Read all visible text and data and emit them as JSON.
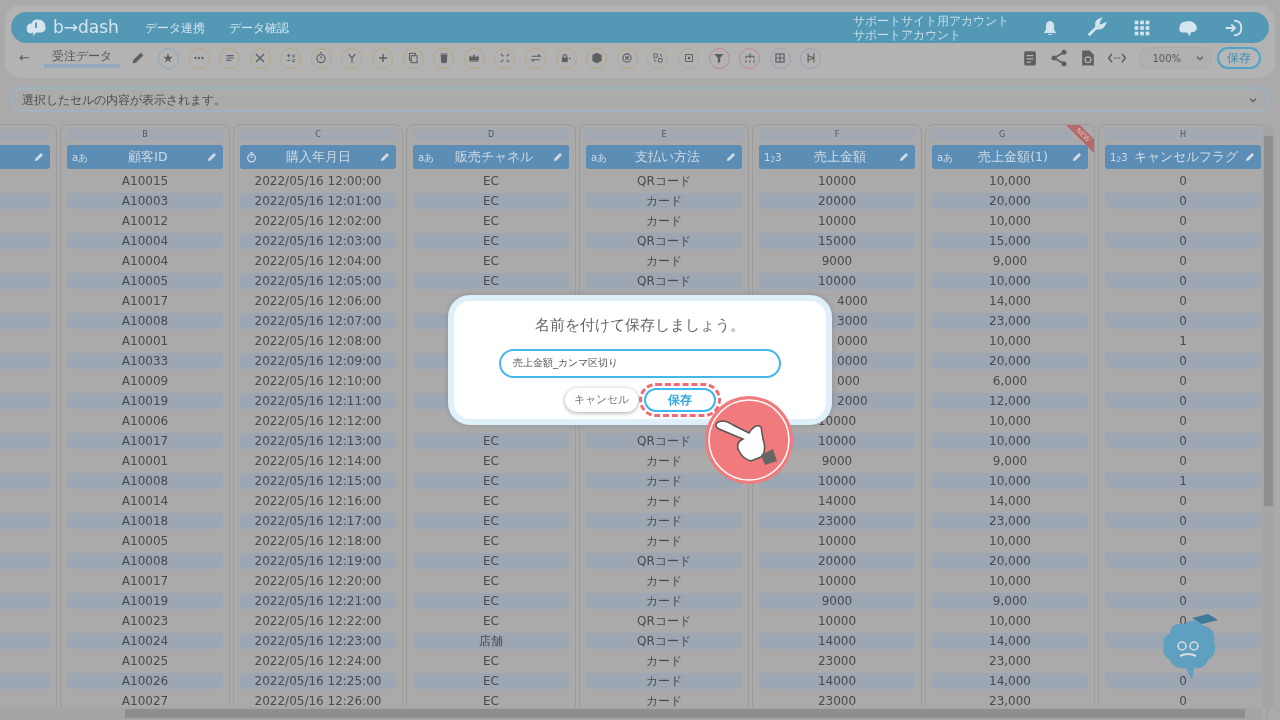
{
  "header": {
    "logo": "b→dash",
    "nav": [
      {
        "label": "データ連携"
      },
      {
        "label": "データ確認"
      }
    ],
    "account": [
      "サポートサイト用アカウント",
      "サポートアカウント"
    ]
  },
  "toolbar": {
    "back": "←",
    "sheet_name": "受注データ",
    "zoom": "100%",
    "save": "保存"
  },
  "formula_bar": {
    "placeholder": "選択したセルの内容が表示されます。"
  },
  "columns": [
    {
      "letter": "B",
      "kind": "text",
      "type_label": "aあ",
      "name": "顧客ID"
    },
    {
      "letter": "C",
      "kind": "datetime",
      "name": "購入年月日"
    },
    {
      "letter": "D",
      "kind": "text",
      "type_label": "aあ",
      "name": "販売チャネル"
    },
    {
      "letter": "E",
      "kind": "text",
      "type_label": "aあ",
      "name": "支払い方法"
    },
    {
      "letter": "F",
      "kind": "number",
      "type_label": "1$_{2}$3",
      "name": "売上金額"
    },
    {
      "letter": "G",
      "kind": "text",
      "type_label": "aあ",
      "name": "売上金額(1)",
      "badge": "NEW"
    },
    {
      "letter": "H",
      "kind": "number",
      "type_label": "1$_{2}$3",
      "name": "キャンセルフラグ"
    }
  ],
  "rows": [
    {
      "covered": false,
      "cells": [
        "A10015",
        "2022/05/16 12:00:00",
        "EC",
        "QRコード",
        "10000",
        "10,000",
        "0"
      ]
    },
    {
      "covered": false,
      "cells": [
        "A10003",
        "2022/05/16 12:01:00",
        "EC",
        "カード",
        "20000",
        "20,000",
        "0"
      ]
    },
    {
      "covered": false,
      "cells": [
        "A10012",
        "2022/05/16 12:02:00",
        "EC",
        "カード",
        "10000",
        "10,000",
        "0"
      ]
    },
    {
      "covered": false,
      "cells": [
        "A10004",
        "2022/05/16 12:03:00",
        "EC",
        "QRコード",
        "15000",
        "15,000",
        "0"
      ]
    },
    {
      "covered": false,
      "cells": [
        "A10004",
        "2022/05/16 12:04:00",
        "EC",
        "カード",
        "9000",
        "9,000",
        "0"
      ]
    },
    {
      "covered": false,
      "cells": [
        "A10005",
        "2022/05/16 12:05:00",
        "EC",
        "QRコード",
        "10000",
        "10,000",
        "0"
      ]
    },
    {
      "covered": true,
      "cells": [
        "A10017",
        "2022/05/16 12:06:00",
        null,
        null,
        "4000",
        "14,000",
        "0"
      ]
    },
    {
      "covered": true,
      "cells": [
        "A10008",
        "2022/05/16 12:07:00",
        null,
        null,
        "3000",
        "23,000",
        "0"
      ]
    },
    {
      "covered": true,
      "cells": [
        "A10001",
        "2022/05/16 12:08:00",
        null,
        null,
        "0000",
        "10,000",
        "1"
      ]
    },
    {
      "covered": true,
      "cells": [
        "A10033",
        "2022/05/16 12:09:00",
        null,
        null,
        "0000",
        "20,000",
        "0"
      ]
    },
    {
      "covered": true,
      "cells": [
        "A10009",
        "2022/05/16 12:10:00",
        null,
        null,
        "000",
        "6,000",
        "0"
      ]
    },
    {
      "covered": true,
      "cells": [
        "A10019",
        "2022/05/16 12:11:00",
        null,
        null,
        "2000",
        "12,000",
        "0"
      ]
    },
    {
      "covered": false,
      "cells": [
        "A10006",
        "2022/05/16 12:12:00",
        null,
        null,
        "10000",
        "10,000",
        "0"
      ]
    },
    {
      "covered": false,
      "cells": [
        "A10017",
        "2022/05/16 12:13:00",
        "EC",
        "QRコード",
        "10000",
        "10,000",
        "0"
      ]
    },
    {
      "covered": false,
      "cells": [
        "A10001",
        "2022/05/16 12:14:00",
        "EC",
        "カード",
        "9000",
        "9,000",
        "0"
      ]
    },
    {
      "covered": false,
      "cells": [
        "A10008",
        "2022/05/16 12:15:00",
        "EC",
        "カード",
        "10000",
        "10,000",
        "1"
      ]
    },
    {
      "covered": false,
      "cells": [
        "A10014",
        "2022/05/16 12:16:00",
        "EC",
        "カード",
        "14000",
        "14,000",
        "0"
      ]
    },
    {
      "covered": false,
      "cells": [
        "A10018",
        "2022/05/16 12:17:00",
        "EC",
        "カード",
        "23000",
        "23,000",
        "0"
      ]
    },
    {
      "covered": false,
      "cells": [
        "A10005",
        "2022/05/16 12:18:00",
        "EC",
        "カード",
        "10000",
        "10,000",
        "0"
      ]
    },
    {
      "covered": false,
      "cells": [
        "A10008",
        "2022/05/16 12:19:00",
        "EC",
        "QRコード",
        "20000",
        "20,000",
        "0"
      ]
    },
    {
      "covered": false,
      "cells": [
        "A10017",
        "2022/05/16 12:20:00",
        "EC",
        "カード",
        "10000",
        "10,000",
        "0"
      ]
    },
    {
      "covered": false,
      "cells": [
        "A10019",
        "2022/05/16 12:21:00",
        "EC",
        "カード",
        "9000",
        "9,000",
        "0"
      ]
    },
    {
      "covered": false,
      "cells": [
        "A10023",
        "2022/05/16 12:22:00",
        "EC",
        "QRコード",
        "10000",
        "10,000",
        "0"
      ]
    },
    {
      "covered": false,
      "cells": [
        "A10024",
        "2022/05/16 12:23:00",
        "店舗",
        "QRコード",
        "14000",
        "14,000",
        null
      ]
    },
    {
      "covered": false,
      "cells": [
        "A10025",
        "2022/05/16 12:24:00",
        "EC",
        "カード",
        "23000",
        "23,000",
        null
      ]
    },
    {
      "covered": false,
      "cells": [
        "A10026",
        "2022/05/16 12:25:00",
        "EC",
        "カード",
        "14000",
        "14,000",
        "0"
      ]
    },
    {
      "covered": false,
      "cells": [
        "A10027",
        "2022/05/16 12:26:00",
        "EC",
        "カード",
        "23000",
        "23,000",
        "0"
      ]
    }
  ],
  "dialog": {
    "title": "名前を付けて保存しましょう。",
    "value": "売上金額_カンマ区切り",
    "buttons": [
      {
        "label": "キャンセル",
        "highlighted": false
      },
      {
        "label": "保存",
        "highlighted": true
      }
    ]
  }
}
